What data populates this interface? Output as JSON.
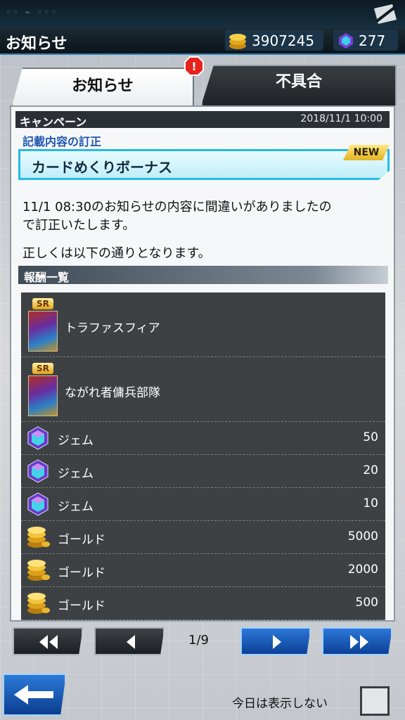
{
  "header": {
    "title": "お知らせ",
    "gold": "3907245",
    "gems": "277"
  },
  "tabs": [
    {
      "label": "お知らせ",
      "active": true,
      "alert": "!"
    },
    {
      "label": "不具合",
      "active": false
    }
  ],
  "notice": {
    "category": "キャンペーン",
    "date": "2018/11/1 10:00",
    "subtitle": "記載内容の訂正",
    "title": "カードめくりボーナス",
    "badge": "NEW",
    "body_line1": "11/1 08:30のお知らせの内容に間違いがありましたの",
    "body_line2": "で訂正いたします。",
    "body_line3": "正しくは以下の通りとなります。"
  },
  "rewards": {
    "header": "報酬一覧",
    "items": [
      {
        "name": "トラファスフィア",
        "qty": "",
        "icon": "card-icon",
        "rarity": "SR"
      },
      {
        "name": "ながれ者傭兵部隊",
        "qty": "",
        "icon": "card-icon",
        "rarity": "SR"
      },
      {
        "name": "ジェム",
        "qty": "50",
        "icon": "gem-icon"
      },
      {
        "name": "ジェム",
        "qty": "20",
        "icon": "gem-icon"
      },
      {
        "name": "ジェム",
        "qty": "10",
        "icon": "gem-icon"
      },
      {
        "name": "ゴールド",
        "qty": "5000",
        "icon": "gold-icon"
      },
      {
        "name": "ゴールド",
        "qty": "2000",
        "icon": "gold-icon"
      },
      {
        "name": "ゴールド",
        "qty": "500",
        "icon": "gold-icon"
      }
    ]
  },
  "pager": {
    "page": "1/9"
  },
  "footer": {
    "dont_show_label": "今日は表示しない"
  },
  "colors": {
    "accent": "#26b9e6",
    "blue_button": "#1d5fc0",
    "panel_dark": "#3e4144"
  }
}
